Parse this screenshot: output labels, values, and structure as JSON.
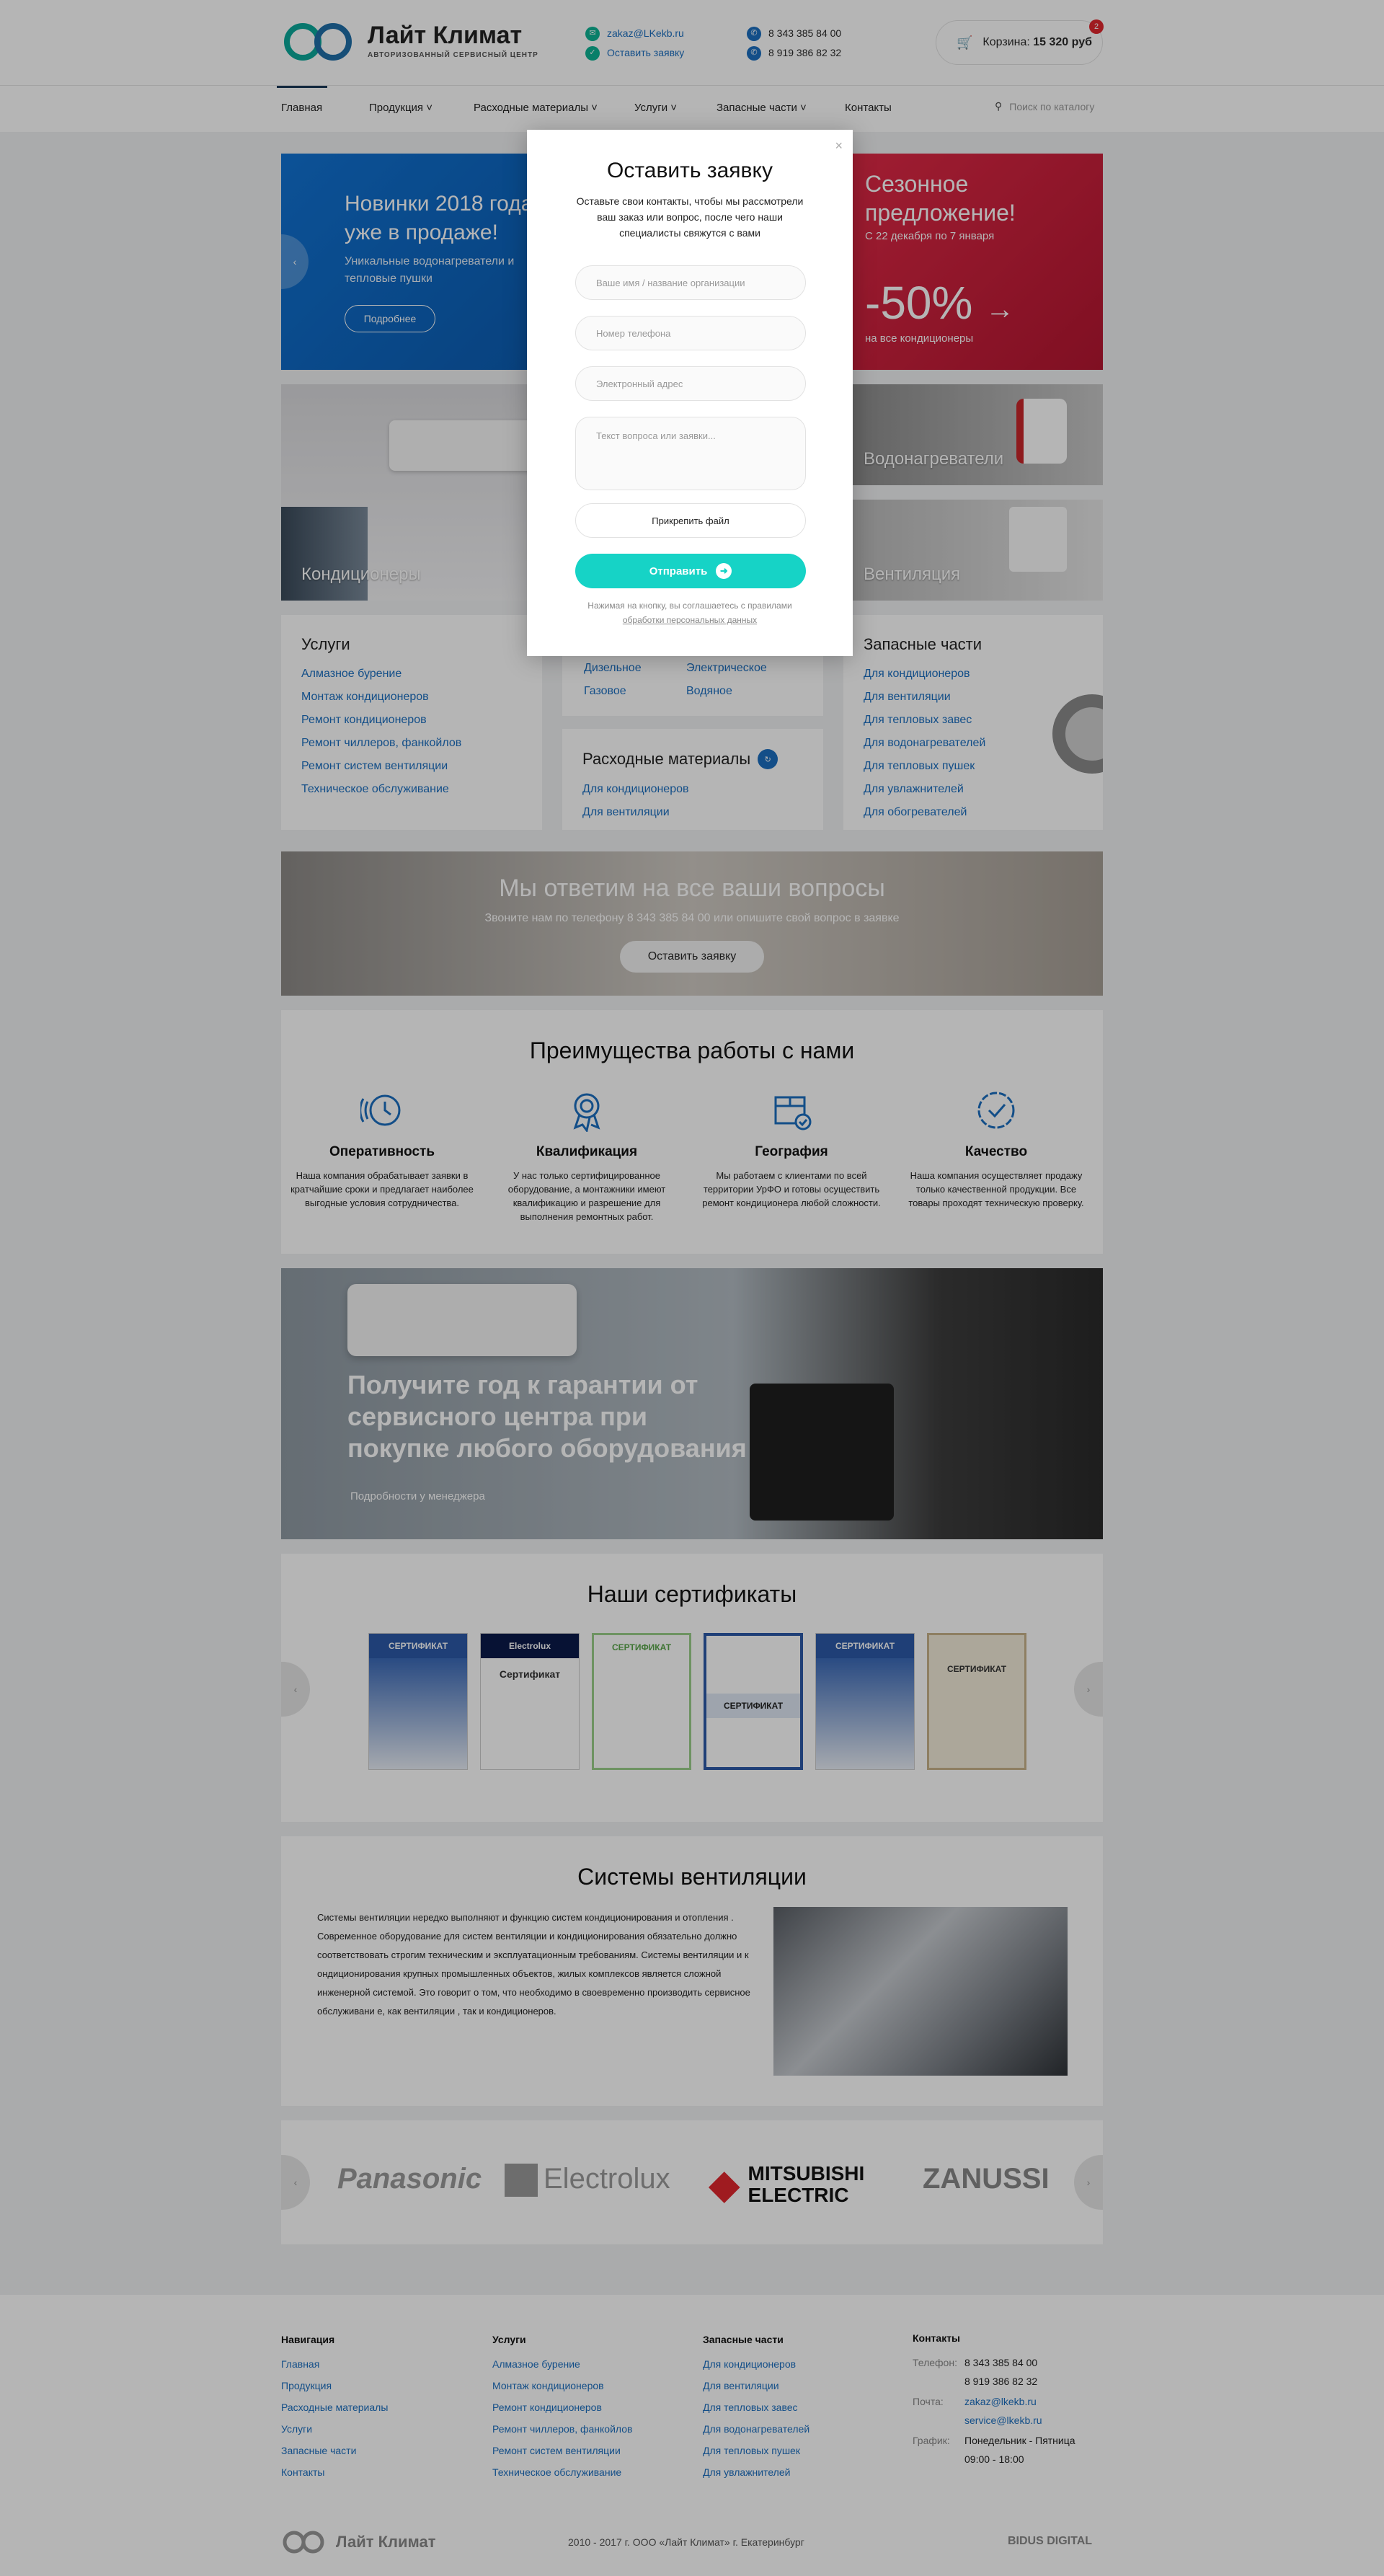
{
  "header": {
    "logo_name": "Лайт Климат",
    "logo_tag": "Авторизованный сервисный центр",
    "email": "zakaz@LKekb.ru",
    "request_link": "Оставить заявку",
    "phone1": "8 343 385 84 00",
    "phone2": "8 919 386 82 32",
    "cart_label": "Корзина:",
    "cart_total": "15 320 руб",
    "cart_count": "2"
  },
  "nav": {
    "items": [
      "Главная",
      "Продукция",
      "Расходные материалы",
      "Услуги",
      "Запасные части",
      "Контакты"
    ],
    "search_placeholder": "Поиск по каталогу"
  },
  "banners": {
    "left_title": "Новинки 2018 года уже в продаже!",
    "left_sub": "Уникальные водонагреватели и тепловые пушки",
    "left_button": "Подробнее",
    "right_title": "Сезонное предложение!",
    "right_dates": "С 22 декабря по 7 января",
    "right_discount": "-50%",
    "right_sub": "на все кондиционеры"
  },
  "products": {
    "ac": "Кондиционеры",
    "water": "Водонагреватели",
    "vent": "Вентиляция"
  },
  "services": {
    "title": "Услуги",
    "items": [
      "Алмазное бурение",
      "Монтаж кондиционеров",
      "Ремонт кондиционеров",
      "Ремонт чиллеров, фанкойлов",
      "Ремонт систем вентиляции",
      "Техническое обслуживание"
    ]
  },
  "mid": {
    "gen_items": [
      "Дизельное",
      "Газовое",
      "Электрическое",
      "Водяное"
    ],
    "consumables_title": "Расходные материалы",
    "consumables_items": [
      "Для кондиционеров",
      "Для вентиляции"
    ]
  },
  "parts": {
    "title": "Запасные части",
    "items": [
      "Для кондиционеров",
      "Для вентиляции",
      "Для тепловых завес",
      "Для водонагревателей",
      "Для тепловых пушек",
      "Для увлажнителей",
      "Для обогревателей"
    ]
  },
  "cta": {
    "title": "Мы ответим на все ваши вопросы",
    "sub": "Звоните нам по телефону 8 343 385 84 00 или опишите свой вопрос в заявке",
    "button": "Оставить заявку"
  },
  "advantages": {
    "title": "Преимущества работы с нами",
    "items": [
      {
        "title": "Оперативность",
        "text": "Наша компания обрабатывает заявки в кратчайшие сроки и предлагает наиболее выгодные условия сотрудничества."
      },
      {
        "title": "Квалификация",
        "text": "У нас только сертифицированное оборудование, а монтажники имеют квалификацию и разрешение для выполнения ремонтных работ."
      },
      {
        "title": "География",
        "text": "Мы работаем с клиентами по всей территории УрФО и готовы осуществить ремонт кондиционера любой сложности."
      },
      {
        "title": "Качество",
        "text": "Наша компания осуществляет продажу только качественной продукции. Все товары проходят техническую проверку."
      }
    ],
    "accent": "#1b6fc0"
  },
  "warranty": {
    "title": "Получите год к гарантии от сервисного центра при покупке любого оборудования",
    "sub": "Подробности у менеджера"
  },
  "certificates": {
    "title": "Наши сертификаты",
    "items": [
      {
        "label": "СЕРТИФИКАТ",
        "body": "",
        "color": "#2c5aa8"
      },
      {
        "label": "Electrolux",
        "body": "Сертификат",
        "color": "#0a1a4a"
      },
      {
        "label": "СЕРТИФИКАТ",
        "body": "",
        "color": "#7dbd6a"
      },
      {
        "label": "СЕРТИФИКАТ",
        "body": "",
        "color": "#2c5aa8"
      },
      {
        "label": "СЕРТИФИКАТ",
        "body": "",
        "color": "#2c5aa8"
      },
      {
        "label": "СЕРТИФИКАТ",
        "body": "",
        "color": "#c9b48a"
      }
    ]
  },
  "ventilation": {
    "title": "Системы вентиляции",
    "text": "Системы вентиляции нередко выполняют и функцию систем кондиционирования и отопления . Современное оборудование для систем вентиляции и кондиционирования обязательно должно соответствовать строгим техническим и эксплуатационным требованиям. Системы вентиляции и к ондиционирования крупных промышленных объектов, жилых комплексов является сложной инженерной системой. Это говорит о том, что необходимо в своевременно производить сервисное обслуживани е, как вентиляции , так и кондиционеров."
  },
  "brands": [
    "Panasonic",
    "Electrolux",
    "MITSUBISHI ELECTRIC",
    "ZANUSSI"
  ],
  "footer": {
    "nav_title": "Навигация",
    "nav_items": [
      "Главная",
      "Продукция",
      "Расходные материалы",
      "Услуги",
      "Запасные части",
      "Контакты"
    ],
    "services_title": "Услуги",
    "services_items": [
      "Алмазное бурение",
      "Монтаж кондиционеров",
      "Ремонт кондиционеров",
      "Ремонт чиллеров, фанкойлов",
      "Ремонт систем вентиляции",
      "Техническое обслуживание"
    ],
    "parts_title": "Запасные части",
    "parts_items": [
      "Для кондиционеров",
      "Для вентиляции",
      "Для тепловых завес",
      "Для водонагревателей",
      "Для тепловых пушек",
      "Для увлажнителей"
    ],
    "contacts_title": "Контакты",
    "phone_label": "Телефон:",
    "phone1": "8 343 385 84 00",
    "phone2": "8 919 386 82 32",
    "mail_label": "Почта:",
    "mail1": "zakaz@lkekb.ru",
    "mail2": "service@lkekb.ru",
    "schedule_label": "График:",
    "schedule_days": "Понедельник - Пятница",
    "schedule_hours": "09:00 - 18:00",
    "copyright": "2010 - 2017 г. ООО «Лайт Климат» г. Екатеринбург",
    "logo": "Лайт Климат",
    "dev": "BIDUS DIGITAL"
  },
  "modal": {
    "title": "Оставить заявку",
    "sub": "Оставьте свои контакты, чтобы мы рассмотрели ваш заказ или вопрос, после чего наши специалисты свяжутся с вами",
    "name_placeholder": "Ваше имя / название организации",
    "phone_placeholder": "Номер телефона",
    "email_placeholder": "Электронный адрес",
    "message_placeholder": "Текст вопроса или заявки...",
    "attach": "Прикрепить файл",
    "send": "Отправить",
    "note": "Нажимая на кнопку, вы соглашаетесь с правилами",
    "note_link": "обработки персональных данных"
  }
}
